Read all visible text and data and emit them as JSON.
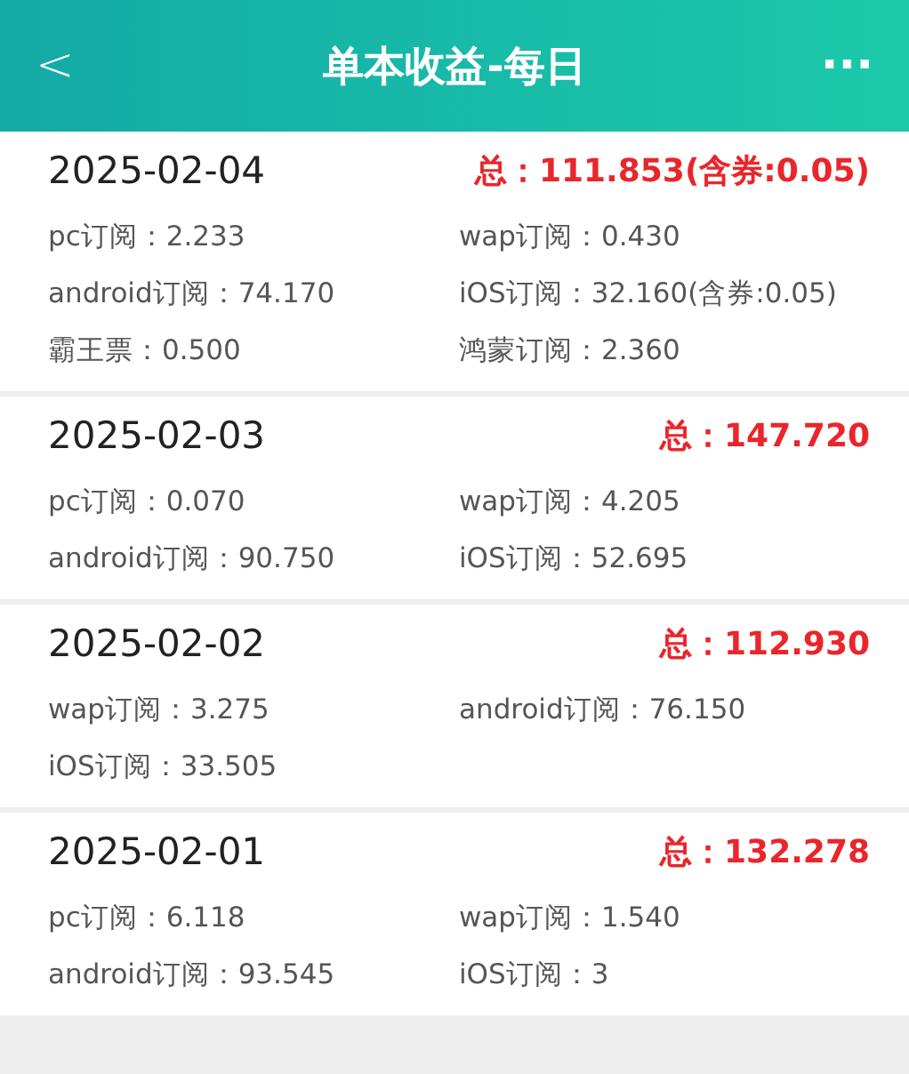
{
  "header": {
    "back": "<",
    "title": "单本收益-每日",
    "more": "···"
  },
  "days": [
    {
      "date": "2025-02-04",
      "total": "总：111.853(含券:0.05)",
      "items": [
        "pc订阅：2.233",
        "wap订阅：0.430",
        "android订阅：74.170",
        "iOS订阅：32.160(含券:0.05)",
        "霸王票：0.500",
        "鸿蒙订阅：2.360"
      ]
    },
    {
      "date": "2025-02-03",
      "total": "总：147.720",
      "items": [
        "pc订阅：0.070",
        "wap订阅：4.205",
        "android订阅：90.750",
        "iOS订阅：52.695"
      ]
    },
    {
      "date": "2025-02-02",
      "total": "总：112.930",
      "items": [
        "wap订阅：3.275",
        "android订阅：76.150",
        "iOS订阅：33.505"
      ]
    },
    {
      "date": "2025-02-01",
      "total": "总：132.278",
      "items": [
        "pc订阅：6.118",
        "wap订阅：1.540",
        "android订阅：93.545",
        "iOS订阅：3"
      ]
    }
  ]
}
